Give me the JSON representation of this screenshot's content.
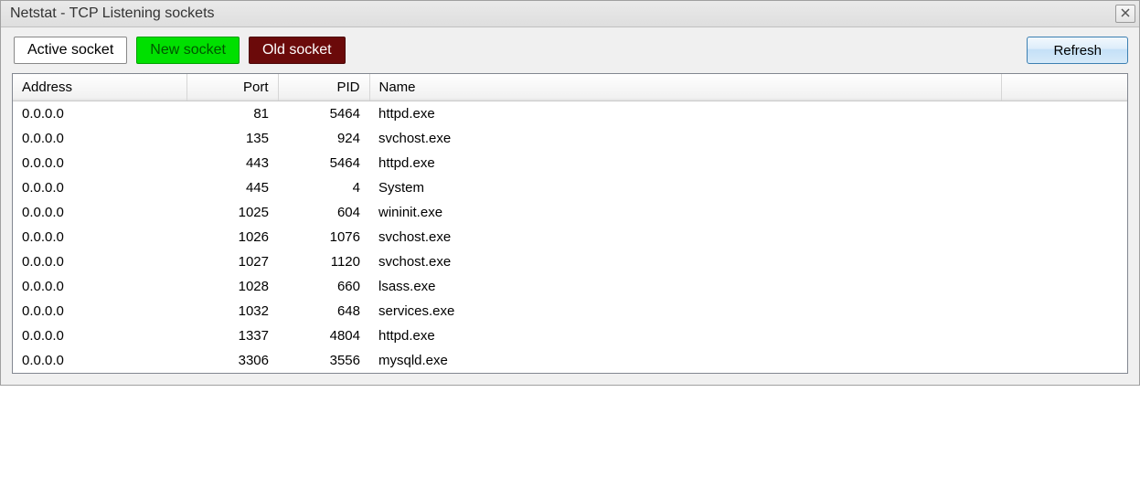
{
  "window": {
    "title": "Netstat - TCP Listening sockets"
  },
  "toolbar": {
    "legend_active": "Active socket",
    "legend_new": "New socket",
    "legend_old": "Old socket",
    "refresh": "Refresh"
  },
  "table": {
    "headers": {
      "address": "Address",
      "port": "Port",
      "pid": "PID",
      "name": "Name"
    },
    "rows": [
      {
        "address": "0.0.0.0",
        "port": "81",
        "pid": "5464",
        "name": "httpd.exe"
      },
      {
        "address": "0.0.0.0",
        "port": "135",
        "pid": "924",
        "name": "svchost.exe"
      },
      {
        "address": "0.0.0.0",
        "port": "443",
        "pid": "5464",
        "name": "httpd.exe"
      },
      {
        "address": "0.0.0.0",
        "port": "445",
        "pid": "4",
        "name": "System"
      },
      {
        "address": "0.0.0.0",
        "port": "1025",
        "pid": "604",
        "name": "wininit.exe"
      },
      {
        "address": "0.0.0.0",
        "port": "1026",
        "pid": "1076",
        "name": "svchost.exe"
      },
      {
        "address": "0.0.0.0",
        "port": "1027",
        "pid": "1120",
        "name": "svchost.exe"
      },
      {
        "address": "0.0.0.0",
        "port": "1028",
        "pid": "660",
        "name": "lsass.exe"
      },
      {
        "address": "0.0.0.0",
        "port": "1032",
        "pid": "648",
        "name": "services.exe"
      },
      {
        "address": "0.0.0.0",
        "port": "1337",
        "pid": "4804",
        "name": "httpd.exe"
      },
      {
        "address": "0.0.0.0",
        "port": "3306",
        "pid": "3556",
        "name": "mysqld.exe"
      }
    ]
  }
}
